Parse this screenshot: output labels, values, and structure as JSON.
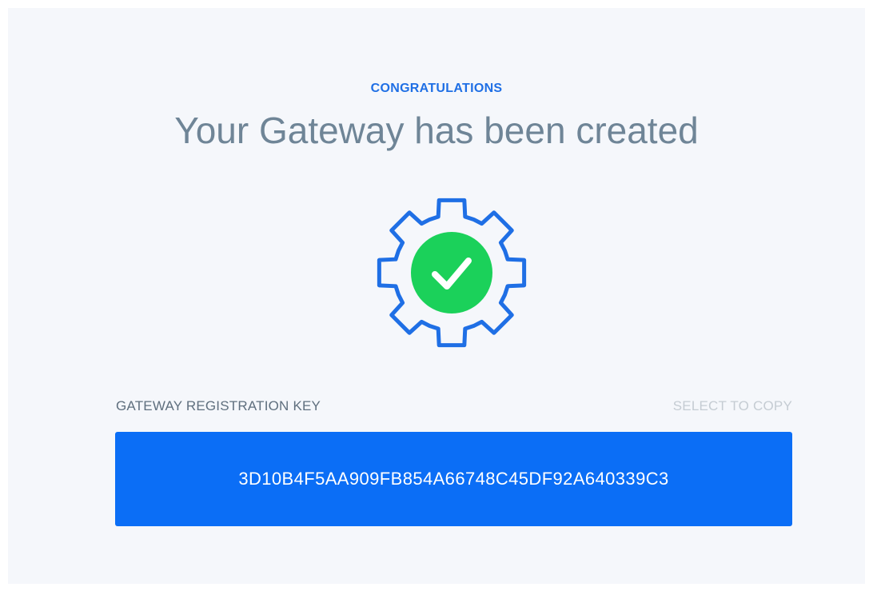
{
  "header": {
    "eyebrow": "CONGRATULATIONS",
    "title": "Your Gateway has been created"
  },
  "status_icon": {
    "icon": "gear-check-icon",
    "gear_color": "#1f6fe5",
    "check_bg_color": "#1bd15a"
  },
  "registration": {
    "label": "GATEWAY REGISTRATION KEY",
    "copy_hint": "SELECT TO COPY",
    "key": "3D10B4F5AA909FB854A66748C45DF92A640339C3",
    "box_color": "#0b6ef6"
  }
}
